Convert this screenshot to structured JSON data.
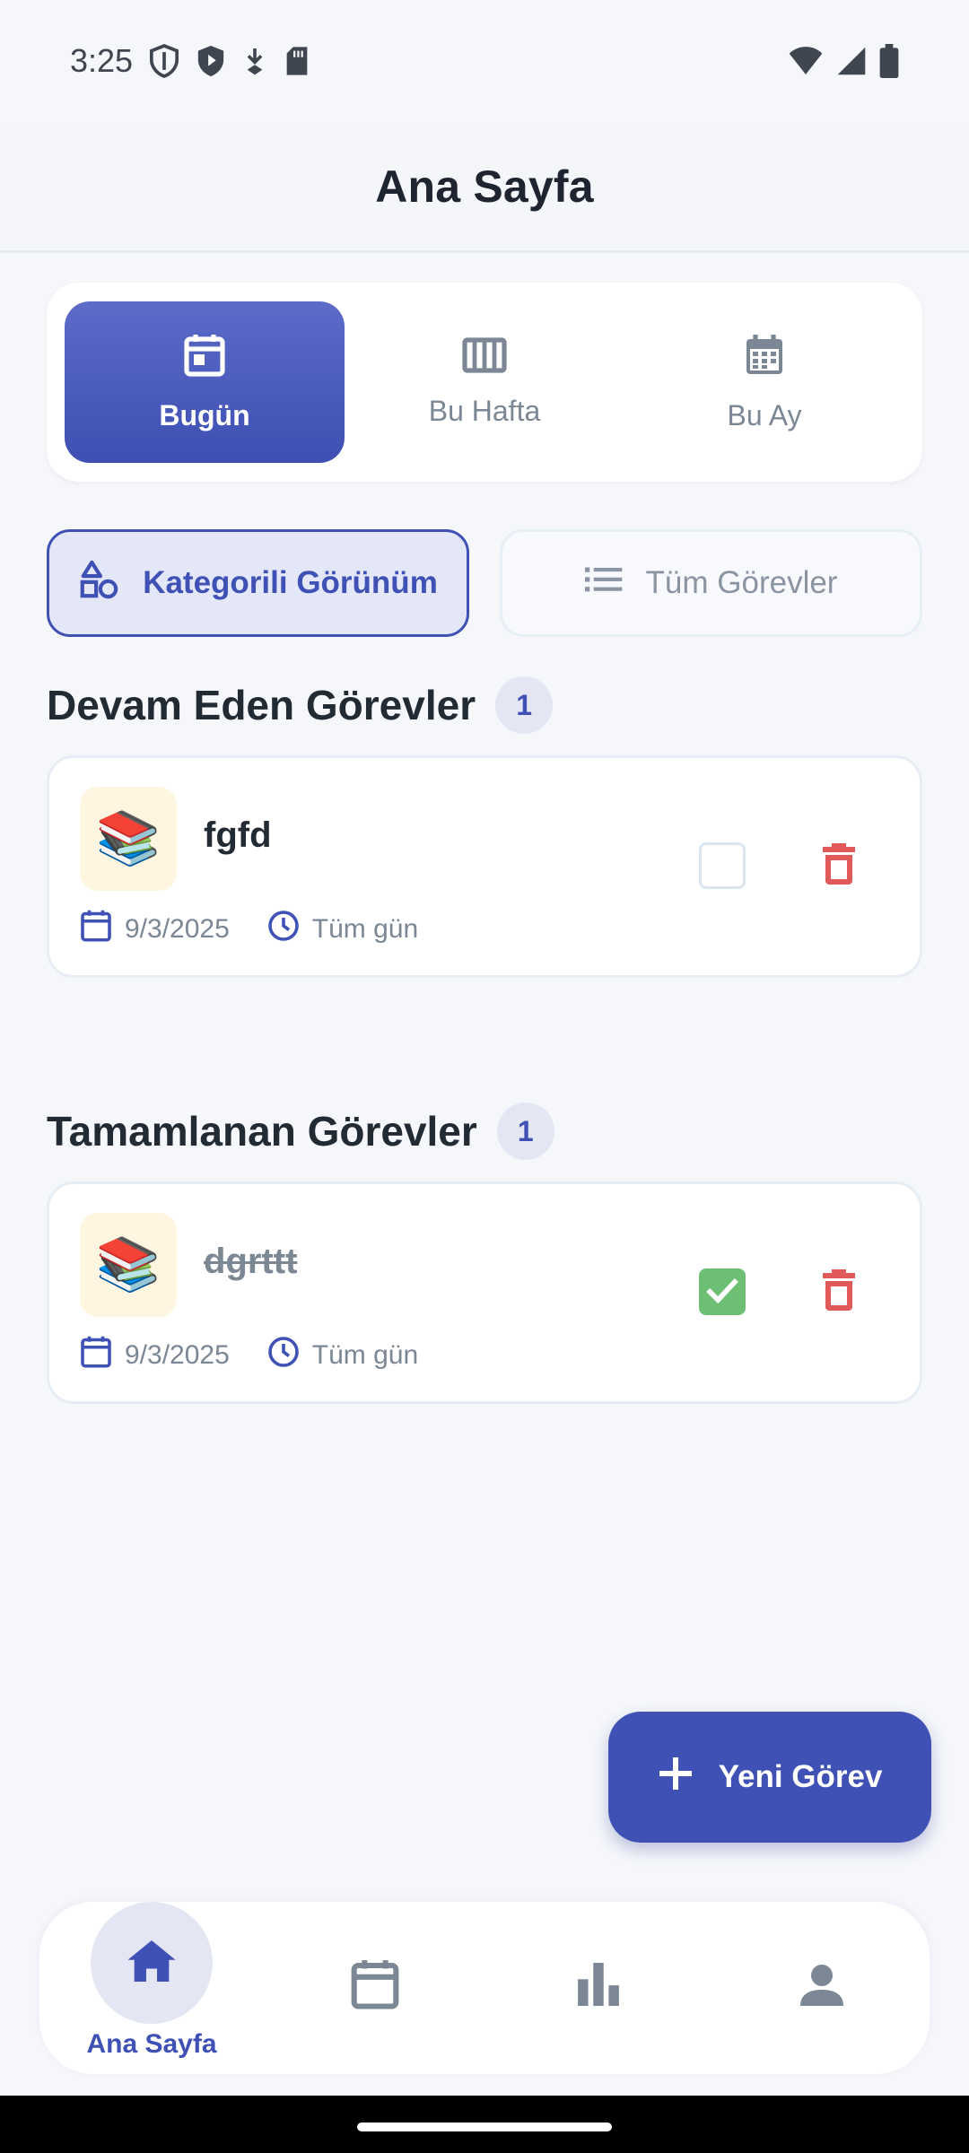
{
  "status_bar": {
    "time": "3:25",
    "left_icons": [
      "shield-outline-icon",
      "shield-play-icon",
      "download-icon",
      "sd-card-icon"
    ],
    "right_icons": [
      "wifi-icon",
      "signal-icon",
      "battery-icon"
    ]
  },
  "header": {
    "title": "Ana Sayfa"
  },
  "period_tabs": [
    {
      "label": "Bugün",
      "icon": "calendar-today-icon",
      "active": true
    },
    {
      "label": "Bu Hafta",
      "icon": "view-week-icon",
      "active": false
    },
    {
      "label": "Bu Ay",
      "icon": "calendar-month-icon",
      "active": false
    }
  ],
  "view_toggle": [
    {
      "label": "Kategorili Görünüm",
      "icon": "category-icon",
      "active": true
    },
    {
      "label": "Tüm Görevler",
      "icon": "list-icon",
      "active": false
    }
  ],
  "sections": {
    "ongoing": {
      "title": "Devam Eden Görevler",
      "count": "1",
      "tasks": [
        {
          "emoji": "📚",
          "title": "fgfd",
          "date": "9/3/2025",
          "time": "Tüm gün",
          "completed": false
        }
      ]
    },
    "completed": {
      "title": "Tamamlanan Görevler",
      "count": "1",
      "tasks": [
        {
          "emoji": "📚",
          "title": "dgrttt",
          "date": "9/3/2025",
          "time": "Tüm gün",
          "completed": true
        }
      ]
    }
  },
  "fab": {
    "label": "Yeni Görev",
    "icon": "plus-icon"
  },
  "bottom_nav": [
    {
      "label": "Ana Sayfa",
      "icon": "home-icon",
      "active": true
    },
    {
      "label": "",
      "icon": "calendar-icon",
      "active": false
    },
    {
      "label": "",
      "icon": "bar-chart-icon",
      "active": false
    },
    {
      "label": "",
      "icon": "person-icon",
      "active": false
    }
  ],
  "colors": {
    "primary": "#3f51b5",
    "background": "#f5f7fb",
    "delete": "#e05a5a",
    "check": "#6dbf73",
    "muted": "#7b8794"
  }
}
